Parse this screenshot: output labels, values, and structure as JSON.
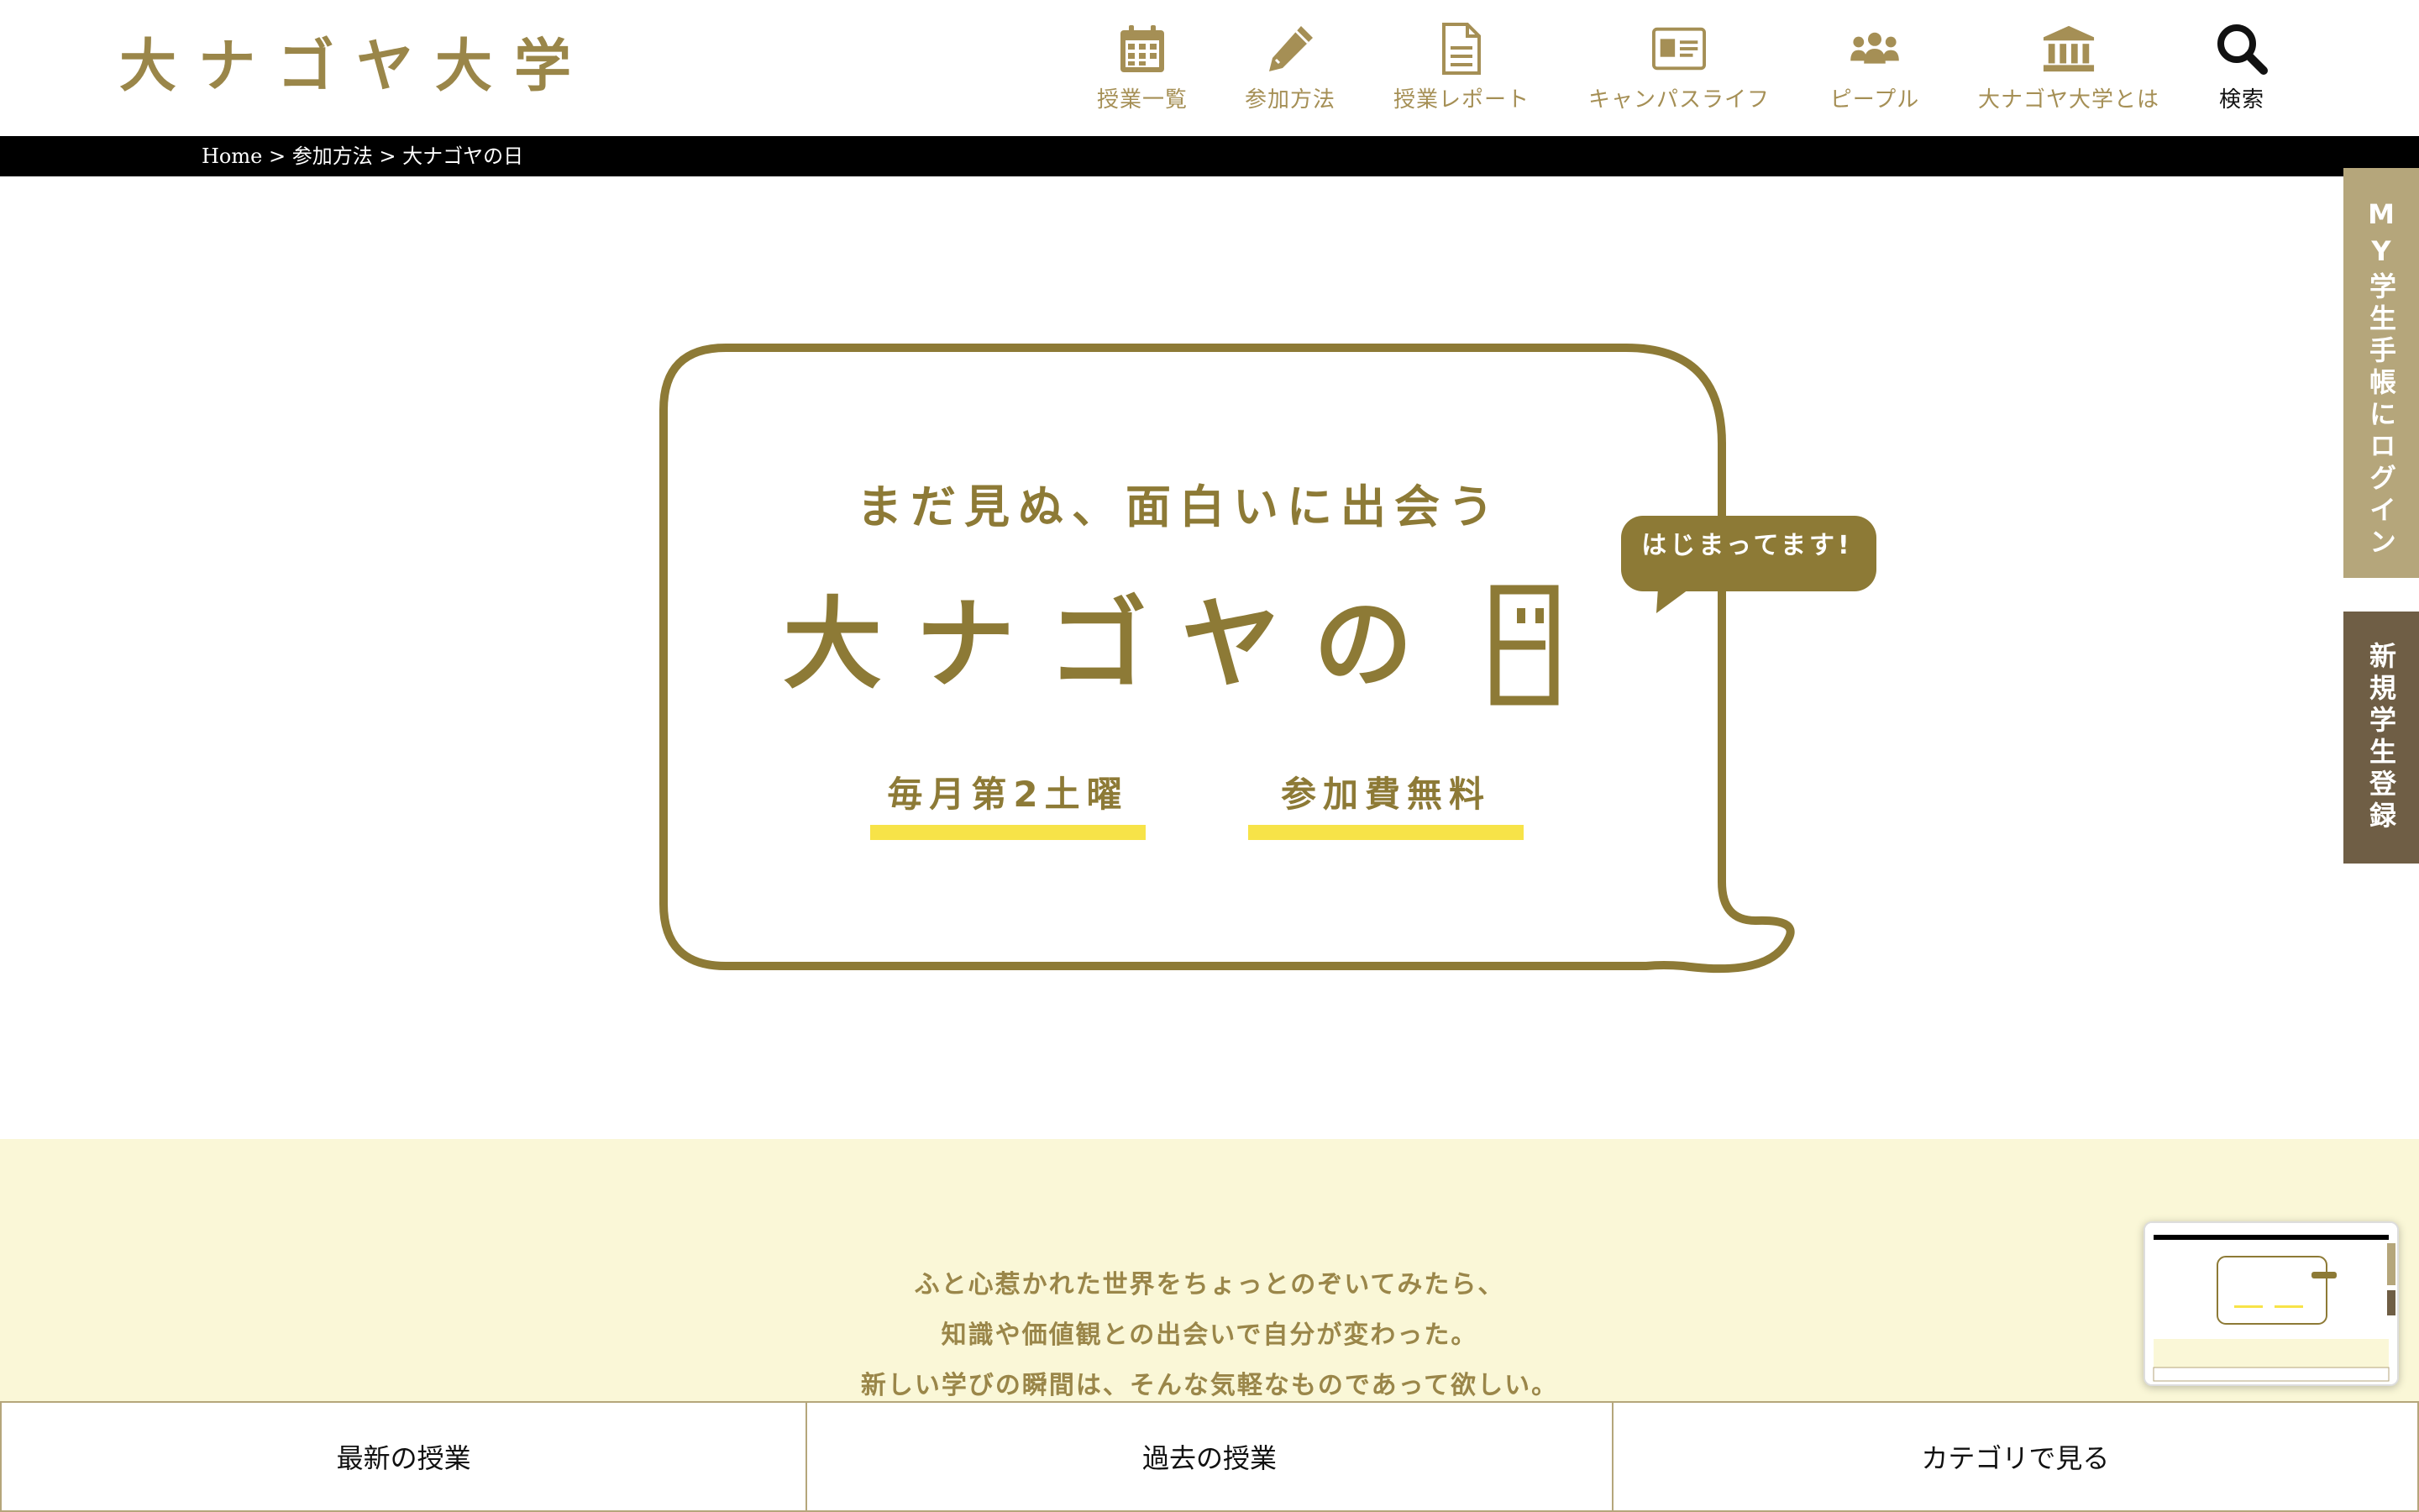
{
  "site": {
    "logo": "大ナゴヤ大学"
  },
  "nav": {
    "items": [
      {
        "label": "授業一覧",
        "icon": "calendar-icon"
      },
      {
        "label": "参加方法",
        "icon": "pencil-icon"
      },
      {
        "label": "授業レポート",
        "icon": "document-icon"
      },
      {
        "label": "キャンパスライフ",
        "icon": "id-card-icon"
      },
      {
        "label": "ピープル",
        "icon": "people-icon"
      },
      {
        "label": "大ナゴヤ大学とは",
        "icon": "institution-icon"
      },
      {
        "label": "検索",
        "icon": "search-icon"
      }
    ]
  },
  "breadcrumb": {
    "home": "Home",
    "sep1": " > ",
    "parent": "参加方法",
    "sep2": " > ",
    "current": "大ナゴヤの日"
  },
  "hero": {
    "tagline": "まだ見ぬ、面白いに出会う",
    "title": "大ナゴヤの",
    "badge": "はじまってます!",
    "pill_1": "毎月第2土曜",
    "pill_2": "参加費無料"
  },
  "side_tabs": {
    "login": "MY学生手帳にログイン",
    "register": "新規学生登録"
  },
  "intro": {
    "lines": [
      "ふと心惹かれた世界をちょっとのぞいてみたら、",
      "知識や価値観との出会いで自分が変わった。",
      "新しい学びの瞬間は、そんな気軽なものであって欲しい。"
    ]
  },
  "bottom_tabs": {
    "latest": "最新の授業",
    "past": "過去の授業",
    "category": "カテゴリで見る"
  },
  "colors": {
    "brand_gold": "#9a8649",
    "hero_olive": "#8d7a36",
    "accent_yellow": "#f7e348",
    "intro_bg": "#faf7d7",
    "login_tab": "#b5a67b",
    "register_tab": "#6f5e45"
  }
}
